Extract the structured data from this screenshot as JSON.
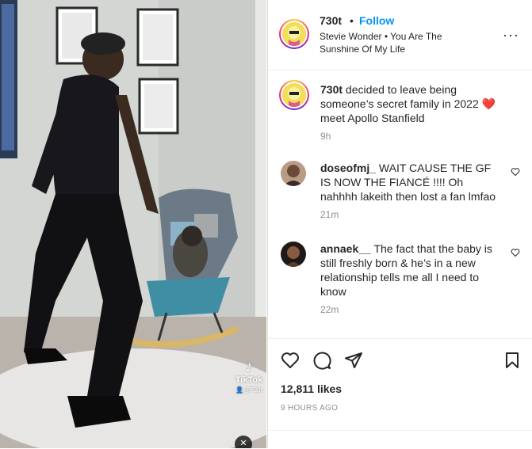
{
  "post": {
    "media": {
      "watermark_glyph": "♪",
      "watermark_name": "TikTok",
      "watermark_handle": "👤@730t",
      "mute_glyph": "✕"
    },
    "header": {
      "username": "730t",
      "separator": "•",
      "follow_label": "Follow",
      "song": "Stevie Wonder • You Are The Sunshine Of My Life",
      "more_glyph": "···"
    },
    "caption": {
      "username": "730t",
      "text": " decided to leave being someone’s secret family in 2022 ❤️ meet Apollo Stanfield",
      "time": "9h"
    },
    "comments": [
      {
        "username": "doseofmj_",
        "text": " WAIT CAUSE THE GF IS NOW THE FIANCÉ !!!! Oh nahhhh lakeith then lost a fan lmfao",
        "time": "21m"
      },
      {
        "username": "annaek__",
        "text": " The fact that the baby is still freshly born & he’s in a new relationship tells me all I need to know",
        "time": "22m"
      }
    ],
    "actions": {
      "icons": [
        "heart-icon",
        "comment-icon",
        "share-icon",
        "bookmark-icon"
      ],
      "likes": "12,811 likes",
      "posted": "9 HOURS AGO"
    }
  }
}
